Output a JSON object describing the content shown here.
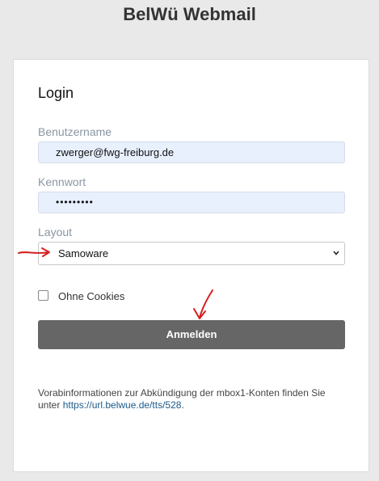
{
  "app": {
    "title": "BelWü Webmail"
  },
  "login": {
    "heading": "Login",
    "username": {
      "label": "Benutzername",
      "value": "zwerger@fwg-freiburg.de"
    },
    "password": {
      "label": "Kennwort",
      "value": "•••••••••"
    },
    "layout": {
      "label": "Layout",
      "selected": "Samoware"
    },
    "cookies": {
      "label": "Ohne Cookies",
      "checked": false
    },
    "submit_label": "Anmelden",
    "info": {
      "text_before": "Vorabinformationen zur Abkündigung der mbox1-Konten finden Sie unter ",
      "link_text": "https://url.belwue.de/tts/528",
      "text_after": "."
    }
  },
  "colors": {
    "background": "#e9e9e9",
    "autofill": "#e8f0fe",
    "button": "#666666",
    "annotation": "#d42020",
    "link": "#1a5a8a"
  },
  "annotations": {
    "icons": [
      "red-arrow-right-icon",
      "red-arrow-down-icon"
    ]
  }
}
